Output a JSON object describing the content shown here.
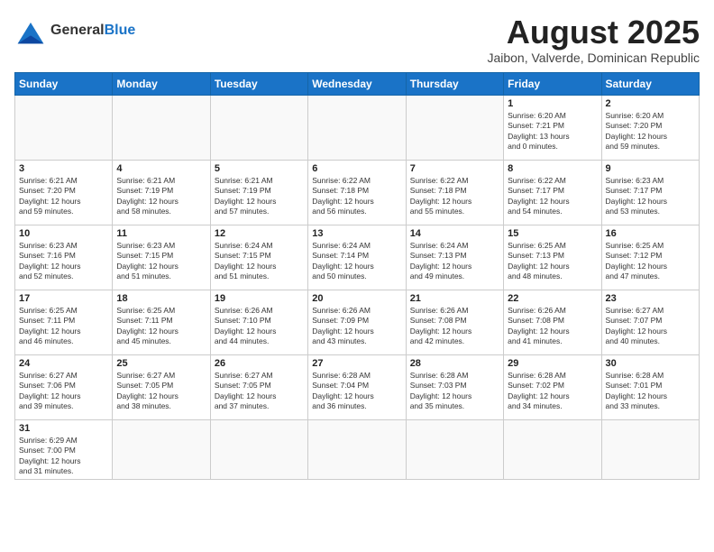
{
  "logo": {
    "text_general": "General",
    "text_blue": "Blue"
  },
  "header": {
    "title": "August 2025",
    "subtitle": "Jaibon, Valverde, Dominican Republic"
  },
  "weekdays": [
    "Sunday",
    "Monday",
    "Tuesday",
    "Wednesday",
    "Thursday",
    "Friday",
    "Saturday"
  ],
  "weeks": [
    [
      {
        "day": "",
        "info": ""
      },
      {
        "day": "",
        "info": ""
      },
      {
        "day": "",
        "info": ""
      },
      {
        "day": "",
        "info": ""
      },
      {
        "day": "",
        "info": ""
      },
      {
        "day": "1",
        "info": "Sunrise: 6:20 AM\nSunset: 7:21 PM\nDaylight: 13 hours\nand 0 minutes."
      },
      {
        "day": "2",
        "info": "Sunrise: 6:20 AM\nSunset: 7:20 PM\nDaylight: 12 hours\nand 59 minutes."
      }
    ],
    [
      {
        "day": "3",
        "info": "Sunrise: 6:21 AM\nSunset: 7:20 PM\nDaylight: 12 hours\nand 59 minutes."
      },
      {
        "day": "4",
        "info": "Sunrise: 6:21 AM\nSunset: 7:19 PM\nDaylight: 12 hours\nand 58 minutes."
      },
      {
        "day": "5",
        "info": "Sunrise: 6:21 AM\nSunset: 7:19 PM\nDaylight: 12 hours\nand 57 minutes."
      },
      {
        "day": "6",
        "info": "Sunrise: 6:22 AM\nSunset: 7:18 PM\nDaylight: 12 hours\nand 56 minutes."
      },
      {
        "day": "7",
        "info": "Sunrise: 6:22 AM\nSunset: 7:18 PM\nDaylight: 12 hours\nand 55 minutes."
      },
      {
        "day": "8",
        "info": "Sunrise: 6:22 AM\nSunset: 7:17 PM\nDaylight: 12 hours\nand 54 minutes."
      },
      {
        "day": "9",
        "info": "Sunrise: 6:23 AM\nSunset: 7:17 PM\nDaylight: 12 hours\nand 53 minutes."
      }
    ],
    [
      {
        "day": "10",
        "info": "Sunrise: 6:23 AM\nSunset: 7:16 PM\nDaylight: 12 hours\nand 52 minutes."
      },
      {
        "day": "11",
        "info": "Sunrise: 6:23 AM\nSunset: 7:15 PM\nDaylight: 12 hours\nand 51 minutes."
      },
      {
        "day": "12",
        "info": "Sunrise: 6:24 AM\nSunset: 7:15 PM\nDaylight: 12 hours\nand 51 minutes."
      },
      {
        "day": "13",
        "info": "Sunrise: 6:24 AM\nSunset: 7:14 PM\nDaylight: 12 hours\nand 50 minutes."
      },
      {
        "day": "14",
        "info": "Sunrise: 6:24 AM\nSunset: 7:13 PM\nDaylight: 12 hours\nand 49 minutes."
      },
      {
        "day": "15",
        "info": "Sunrise: 6:25 AM\nSunset: 7:13 PM\nDaylight: 12 hours\nand 48 minutes."
      },
      {
        "day": "16",
        "info": "Sunrise: 6:25 AM\nSunset: 7:12 PM\nDaylight: 12 hours\nand 47 minutes."
      }
    ],
    [
      {
        "day": "17",
        "info": "Sunrise: 6:25 AM\nSunset: 7:11 PM\nDaylight: 12 hours\nand 46 minutes."
      },
      {
        "day": "18",
        "info": "Sunrise: 6:25 AM\nSunset: 7:11 PM\nDaylight: 12 hours\nand 45 minutes."
      },
      {
        "day": "19",
        "info": "Sunrise: 6:26 AM\nSunset: 7:10 PM\nDaylight: 12 hours\nand 44 minutes."
      },
      {
        "day": "20",
        "info": "Sunrise: 6:26 AM\nSunset: 7:09 PM\nDaylight: 12 hours\nand 43 minutes."
      },
      {
        "day": "21",
        "info": "Sunrise: 6:26 AM\nSunset: 7:08 PM\nDaylight: 12 hours\nand 42 minutes."
      },
      {
        "day": "22",
        "info": "Sunrise: 6:26 AM\nSunset: 7:08 PM\nDaylight: 12 hours\nand 41 minutes."
      },
      {
        "day": "23",
        "info": "Sunrise: 6:27 AM\nSunset: 7:07 PM\nDaylight: 12 hours\nand 40 minutes."
      }
    ],
    [
      {
        "day": "24",
        "info": "Sunrise: 6:27 AM\nSunset: 7:06 PM\nDaylight: 12 hours\nand 39 minutes."
      },
      {
        "day": "25",
        "info": "Sunrise: 6:27 AM\nSunset: 7:05 PM\nDaylight: 12 hours\nand 38 minutes."
      },
      {
        "day": "26",
        "info": "Sunrise: 6:27 AM\nSunset: 7:05 PM\nDaylight: 12 hours\nand 37 minutes."
      },
      {
        "day": "27",
        "info": "Sunrise: 6:28 AM\nSunset: 7:04 PM\nDaylight: 12 hours\nand 36 minutes."
      },
      {
        "day": "28",
        "info": "Sunrise: 6:28 AM\nSunset: 7:03 PM\nDaylight: 12 hours\nand 35 minutes."
      },
      {
        "day": "29",
        "info": "Sunrise: 6:28 AM\nSunset: 7:02 PM\nDaylight: 12 hours\nand 34 minutes."
      },
      {
        "day": "30",
        "info": "Sunrise: 6:28 AM\nSunset: 7:01 PM\nDaylight: 12 hours\nand 33 minutes."
      }
    ],
    [
      {
        "day": "31",
        "info": "Sunrise: 6:29 AM\nSunset: 7:00 PM\nDaylight: 12 hours\nand 31 minutes."
      },
      {
        "day": "",
        "info": ""
      },
      {
        "day": "",
        "info": ""
      },
      {
        "day": "",
        "info": ""
      },
      {
        "day": "",
        "info": ""
      },
      {
        "day": "",
        "info": ""
      },
      {
        "day": "",
        "info": ""
      }
    ]
  ]
}
